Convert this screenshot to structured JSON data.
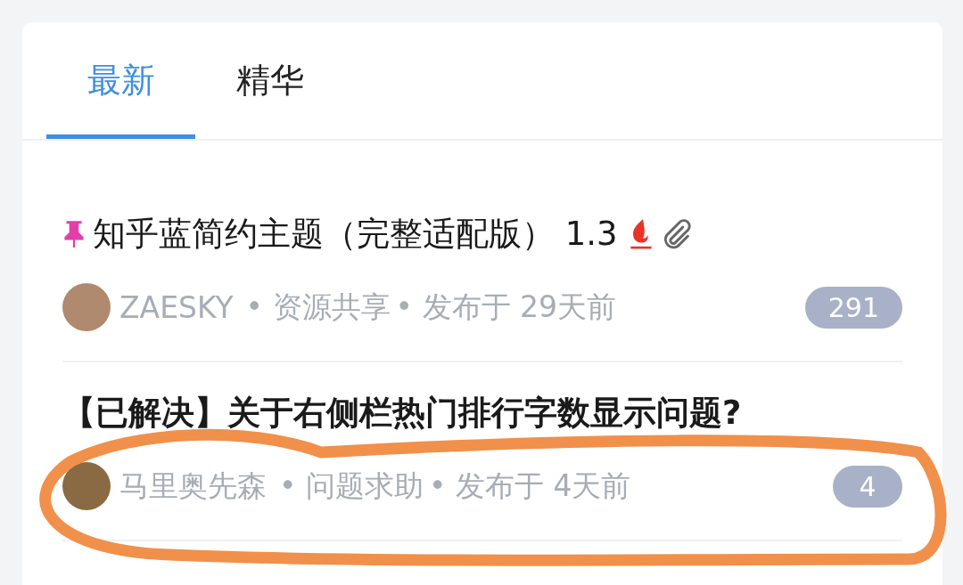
{
  "tabs": [
    {
      "label": "最新",
      "selected": true
    },
    {
      "label": "精华",
      "selected": false
    }
  ],
  "posts": [
    {
      "title": "知乎蓝简约主题（完整适配版） 1.3",
      "pinned": true,
      "hot": true,
      "attachment": true,
      "author": "ZAESKY",
      "category": "• 资源共享",
      "time": "• 发布于 29天前",
      "replies": "291"
    },
    {
      "title": "【已解决】关于右侧栏热门排行字数显示问题?",
      "pinned": false,
      "hot": false,
      "attachment": false,
      "author": "马里奥先森",
      "category": "• 问题求助",
      "time": "• 发布于 4天前",
      "replies": "4"
    }
  ]
}
